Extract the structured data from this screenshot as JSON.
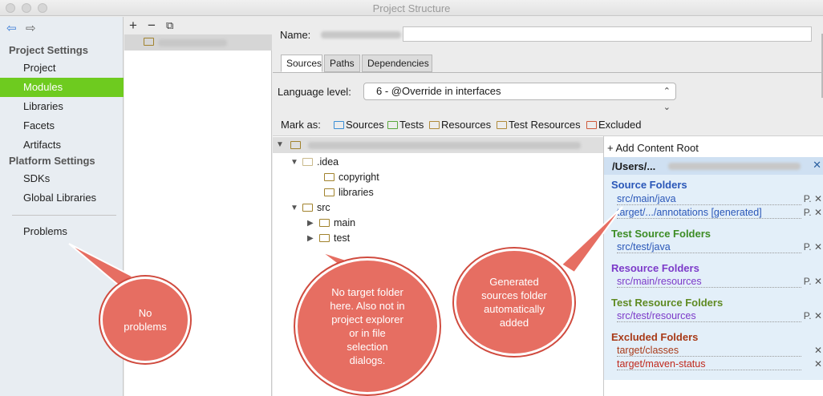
{
  "window": {
    "title": "Project Structure"
  },
  "nav": {
    "back_icon": "arrow-left-icon",
    "forward_icon": "arrow-right-icon",
    "project_settings_label": "Project Settings",
    "project_items": [
      "Project",
      "Modules",
      "Libraries",
      "Facets",
      "Artifacts"
    ],
    "platform_settings_label": "Platform Settings",
    "platform_items": [
      "SDKs",
      "Global Libraries"
    ],
    "problems_label": "Problems",
    "selected": "Modules",
    "selected_color": "#6ecb1f"
  },
  "module_list": {
    "toolbar": {
      "add": "+",
      "remove": "−",
      "copy_icon": "copy-icon"
    }
  },
  "module": {
    "name_label": "Name:",
    "tabs": [
      "Sources",
      "Paths",
      "Dependencies"
    ],
    "active_tab": "Sources",
    "language_level_label": "Language level:",
    "language_level_value": "6 - @Override in interfaces",
    "mark_as_label": "Mark as:",
    "mark_as": [
      {
        "label": "Sources",
        "color": "#3b8fd6"
      },
      {
        "label": "Tests",
        "color": "#5aa83c"
      },
      {
        "label": "Resources",
        "color": "#b08a3a"
      },
      {
        "label": "Test Resources",
        "color": "#b08a3a"
      },
      {
        "label": "Excluded",
        "color": "#d05a3b"
      }
    ]
  },
  "tree": {
    "nodes": [
      {
        "label": ".idea",
        "expanded": true
      },
      {
        "label": "copyright"
      },
      {
        "label": "libraries"
      },
      {
        "label": "src",
        "expanded": true
      },
      {
        "label": "main",
        "expanded": false
      },
      {
        "label": "test",
        "expanded": false
      }
    ]
  },
  "content_root": {
    "add_label": "+ Add Content Root",
    "path": "/Users/...",
    "groups": [
      {
        "title": "Source Folders",
        "color": "#2a57b8",
        "items": [
          "src/main/java",
          "target/.../annotations [generated]"
        ]
      },
      {
        "title": "Test Source Folders",
        "color": "#3c8c24",
        "items": [
          "src/test/java"
        ]
      },
      {
        "title": "Resource Folders",
        "color": "#7c3ac9",
        "items": [
          "src/main/resources"
        ]
      },
      {
        "title": "Test Resource Folders",
        "color": "#5f8a22",
        "items": [
          "src/test/resources"
        ]
      },
      {
        "title": "Excluded Folders",
        "color": "#a83a18",
        "items": [
          "target/classes",
          "target/maven-status"
        ]
      }
    ],
    "item_actions": "P.",
    "close_glyph": "✕"
  },
  "callouts": [
    {
      "lines": [
        "No",
        "problems"
      ]
    },
    {
      "lines": [
        "No target folder",
        "here. Also not in",
        "project explorer",
        "or in file",
        "selection",
        "dialogs."
      ]
    },
    {
      "lines": [
        "Generated",
        "sources folder",
        "automatically",
        "added"
      ]
    }
  ]
}
